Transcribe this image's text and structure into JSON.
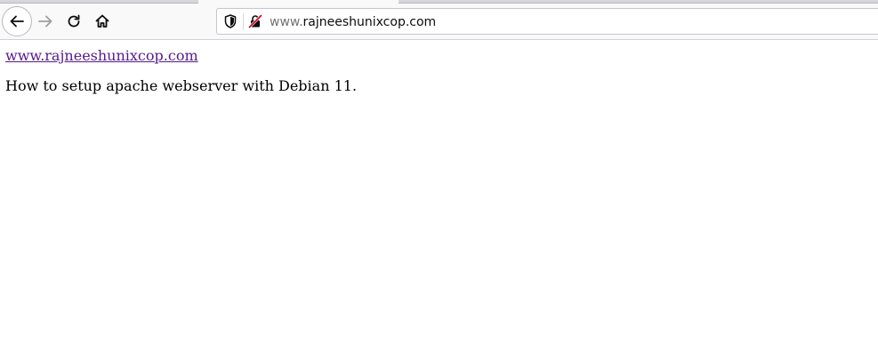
{
  "browser": {
    "url_prefix": "www.",
    "url_domain": "rajneeshunixcop.com",
    "icons": {
      "back": "back-arrow-icon",
      "forward": "forward-arrow-icon",
      "reload": "reload-icon",
      "home": "home-icon",
      "tracking": "shield-icon",
      "security": "insecure-connection-icon"
    },
    "colors": {
      "insecure_icon": "#d70022",
      "visited_link": "#551a8b"
    }
  },
  "page": {
    "link_text": "www.rajneeshunixcop.com",
    "paragraph": "How to setup apache webserver with Debian 11."
  }
}
